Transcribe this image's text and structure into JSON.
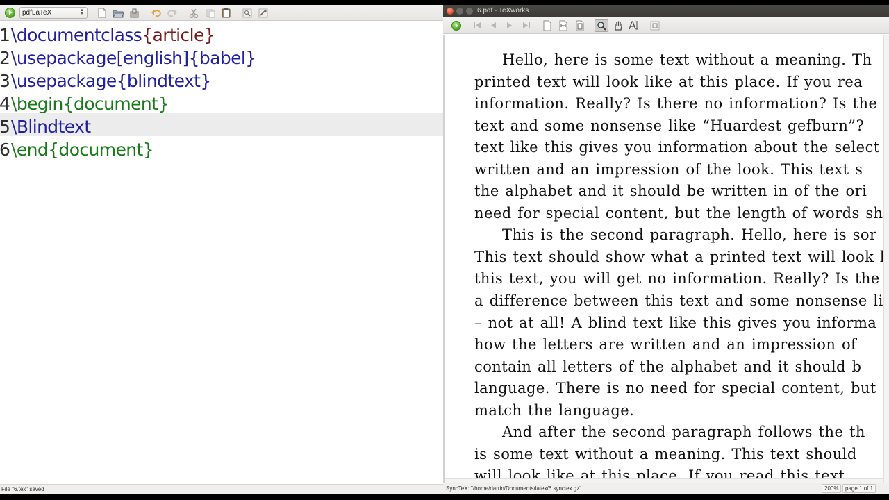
{
  "editor": {
    "engine": "pdfLaTeX",
    "toolbar_icons": [
      "new-file-icon",
      "open-file-icon",
      "save-file-icon",
      "undo-icon",
      "redo-icon",
      "cut-icon",
      "copy-icon",
      "paste-icon",
      "find-icon",
      "replace-icon"
    ],
    "lines": [
      {
        "num": "1",
        "parts": [
          {
            "t": "\\documentclass",
            "c": "cmd"
          },
          {
            "t": "{article}",
            "c": "arg"
          }
        ]
      },
      {
        "num": "2",
        "parts": [
          {
            "t": "\\usepackage[english]{babel}",
            "c": "cmd"
          }
        ]
      },
      {
        "num": "3",
        "parts": [
          {
            "t": "\\usepackage{blindtext}",
            "c": "cmd"
          }
        ]
      },
      {
        "num": "4",
        "parts": [
          {
            "t": "\\begin{document}",
            "c": "env"
          }
        ]
      },
      {
        "num": "5",
        "parts": [
          {
            "t": "\\Blindtext",
            "c": "cmd"
          }
        ]
      },
      {
        "num": "6",
        "parts": [
          {
            "t": "\\end{document}",
            "c": "env"
          }
        ]
      }
    ],
    "current_line": 5,
    "status": "File \"6.tex\" saved"
  },
  "viewer": {
    "title": "6.pdf - TeXworks",
    "toolbar_icons": [
      "first-page-icon",
      "previous-page-icon",
      "next-page-icon",
      "last-page-icon",
      "actual-size-icon",
      "fit-width-icon",
      "fit-window-icon",
      "magnify-icon",
      "hand-tool-icon",
      "select-text-icon",
      "go-to-source-icon"
    ],
    "pdf_lines": [
      {
        "text": "Hello, here is some text without a meaning.  Th",
        "indent": true
      },
      {
        "text": "printed text will look like at this place.  If you rea",
        "indent": false
      },
      {
        "text": "information.  Really? Is there no information? Is the",
        "indent": false
      },
      {
        "text": "text and some nonsense like “Huardest gefburn”?",
        "indent": false
      },
      {
        "text": "text like this gives you information about the select",
        "indent": false
      },
      {
        "text": "written and an impression of the look.  This text s",
        "indent": false
      },
      {
        "text": "the alphabet and it should be written in of the ori",
        "indent": false
      },
      {
        "text": "need for special content, but the length of words sh",
        "indent": false
      },
      {
        "text": "This is the second paragraph.  Hello, here is sor",
        "indent": true
      },
      {
        "text": "This text should show what a printed text will look l",
        "indent": false
      },
      {
        "text": "this text, you will get no information.  Really? Is the",
        "indent": false
      },
      {
        "text": "a difference between this text and some nonsense like",
        "indent": false
      },
      {
        "text": "– not at all! A blind text like this gives you informa",
        "indent": false
      },
      {
        "text": "how the letters are written and an impression of",
        "indent": false
      },
      {
        "text": "contain all letters of the alphabet and it should b",
        "indent": false
      },
      {
        "text": "language.  There is no need for special content, but",
        "indent": false
      },
      {
        "text": "match the language.",
        "indent": false
      },
      {
        "text": "And after the second paragraph follows the th",
        "indent": true
      },
      {
        "text": "is some text without a meaning.  This text should",
        "indent": false
      },
      {
        "text": "will look like at this place.  If you read this text,",
        "indent": false
      }
    ],
    "status": {
      "synctex": "SyncTeX: \"/home/darrin/Documents/latex/6.synctex.gz\"",
      "zoom": "200%",
      "page": "page 1 of 1"
    }
  }
}
